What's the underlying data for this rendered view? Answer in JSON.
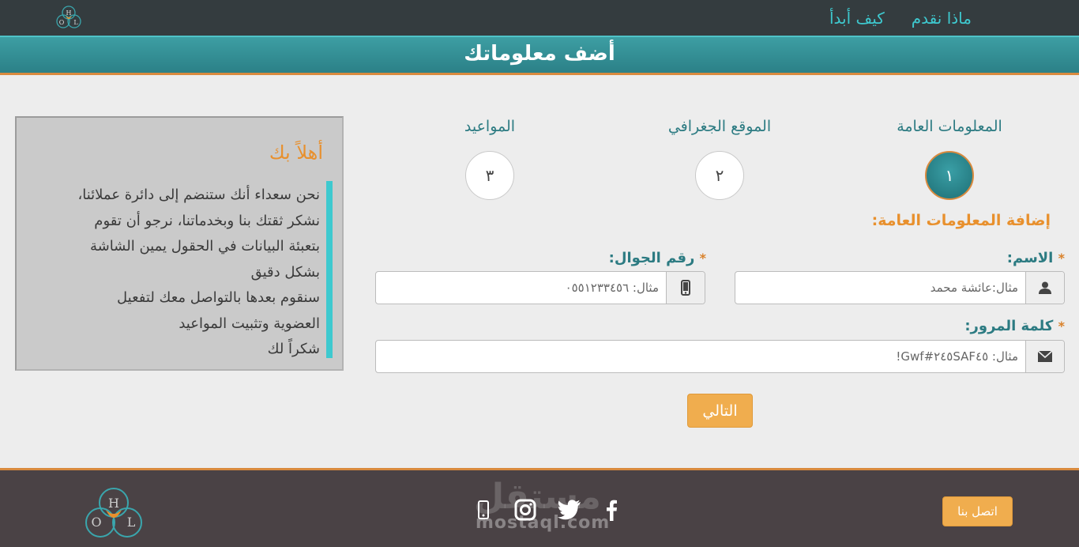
{
  "nav": {
    "items": [
      "ماذا نقدم",
      "كيف أبدأ"
    ]
  },
  "page": {
    "title": "أضف معلوماتك"
  },
  "steps": [
    {
      "label": "المعلومات العامة",
      "number": "١"
    },
    {
      "label": "الموقع الجغرافي",
      "number": "٢"
    },
    {
      "label": "المواعيد",
      "number": "٣"
    }
  ],
  "form": {
    "section_title": "إضافة المعلومات العامة:",
    "name": {
      "label": "الاسم:",
      "placeholder": "مثال:عائشة محمد"
    },
    "phone": {
      "label": "رقم الجوال:",
      "placeholder": "مثال: ٠٥٥١٢٣٣٤٥٦"
    },
    "password": {
      "label": "كلمة المرور:",
      "placeholder": "مثال: ٢٤٥SAF٤٥#Gwf!"
    },
    "required_mark": "*",
    "next_label": "التالي"
  },
  "welcome": {
    "title": "أهلاً بك",
    "lines": [
      "نحن سعداء أنك ستنضم إلى دائرة عملائنا،",
      "نشكر ثقتك بنا وبخدماتنا، نرجو أن تقوم",
      "بتعبئة البيانات في الحقول يمين الشاشة",
      "بشكل دقيق",
      "سنقوم بعدها بالتواصل معك لتفعيل",
      "العضوية وتثبيت المواعيد",
      "شكراً لك"
    ]
  },
  "footer": {
    "contact_label": "اتصل بنا",
    "watermark": "mostaql.com",
    "watermark_ar": "مستقل"
  },
  "logo": {
    "letters": [
      "H",
      "O",
      "L"
    ]
  },
  "colors": {
    "teal": "#2c7b82",
    "accent_cyan": "#3ec9cf",
    "orange": "#e8902d",
    "button": "#f0ad4e",
    "dark": "#343c3f",
    "footer": "#4a4245"
  },
  "icons": {
    "name_addon": "user-icon",
    "phone_addon": "mobile-phone-icon",
    "password_addon": "envelope-icon",
    "socials": [
      "facebook-icon",
      "twitter-icon",
      "instagram-icon",
      "mobile-phone-icon"
    ]
  }
}
